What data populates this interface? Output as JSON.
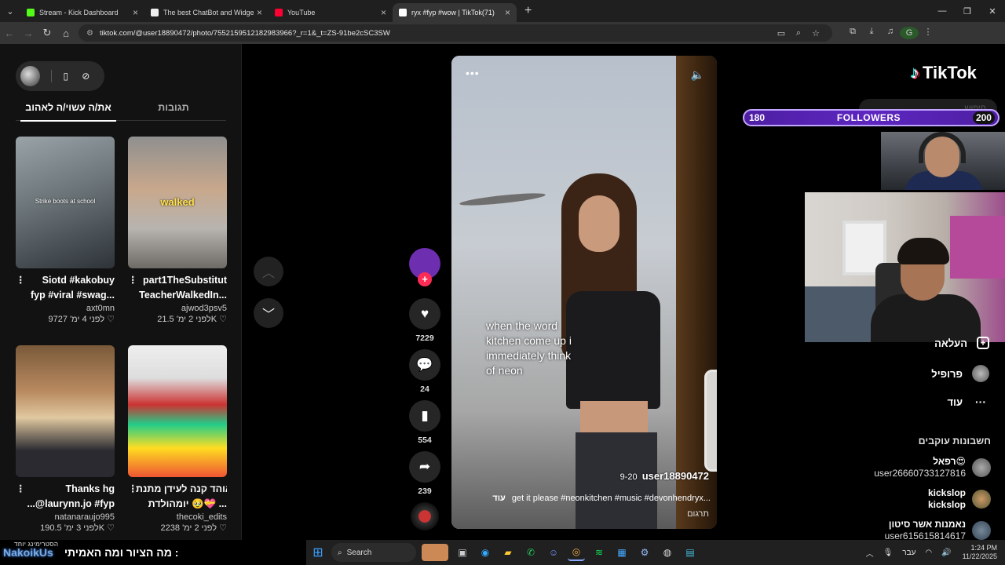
{
  "browser": {
    "tabs": [
      {
        "title": "Stream - Kick Dashboard",
        "color": "#53fc18",
        "active": false
      },
      {
        "title": "The best ChatBot and Widgets",
        "color": "#eeeeee",
        "active": false
      },
      {
        "title": "YouTube",
        "color": "#ff0033",
        "active": false
      },
      {
        "title": "ryx #fyp #wow | TikTok(71)",
        "color": "#ffffff",
        "active": true
      }
    ],
    "url": "tiktok.com/@user18890472/photo/7552159512182983966?_r=1&_t=ZS-91be2cSC3SW"
  },
  "left_panel": {
    "tabs": [
      {
        "label": "את/ה עשוי/ה לאהוב",
        "selected": true
      },
      {
        "label": "תגובות",
        "selected": false
      }
    ],
    "cards": [
      {
        "caption": "Strike boots at school",
        "title1": "Siotd #kakobuy",
        "title2": "fyp #viral #swag...",
        "author": "axt0mn",
        "meta": "לפני 4 ימ' 9727 ♡",
        "bg": "linear-gradient(160deg,#9aa3a8,#6b7478 45%,#2d3338)"
      },
      {
        "caption": "walked",
        "title1": "part1TheSubstitut",
        "title2": "TeacherWalkedIn...",
        "author": "ajwod3psv5",
        "meta": "לפני 2 ימ' 21.5K ♡",
        "bg": "linear-gradient(180deg,#8f8f8f,#c8a88c 40%,#b7b4b0 70%,#6e6a66)"
      },
      {
        "caption": "",
        "title1": "Thanks hg",
        "title2": "...@laurynn.jo #fyp",
        "author": "natanaraujo995",
        "meta": "לפני 3 ימ' 190.5K ♡",
        "bg": "linear-gradient(180deg,#7a5a3a,#b98a60 35%,#e0c8a0 55%,#2a2a30 80%)"
      },
      {
        "caption": "",
        "title1": "אוהד קנה לעידן מתנת",
        "title2": "יומהולדת 🥹💝 ...",
        "author": "thecoki_edits",
        "meta": "לפני 2 ימ' 2238 ♡",
        "bg": "linear-gradient(180deg,#eee 0%,#ddd 25%,#c33 45%,#2c8 60%,#fd2 78%,#e53 100%)"
      }
    ]
  },
  "video": {
    "overlay_text": [
      "when the word",
      "kitchen come up i",
      "immediately think",
      "of neon"
    ],
    "username": "user18890472",
    "date": "9-20",
    "description": "get it please #neonkitchen #music #devonhendryx...",
    "more_label": "עוד",
    "translate_label": "תרגום"
  },
  "actions": {
    "likes": "7229",
    "comments": "24",
    "saves": "554",
    "shares": "239"
  },
  "right_panel": {
    "logo": "TikTok",
    "search_placeholder": "חיפוש",
    "followers_overlay": {
      "current": "180",
      "label": "FOLLOWERS",
      "goal": "200"
    },
    "nav": [
      {
        "label": "העלאה",
        "icon": "upload-icon"
      },
      {
        "label": "פרופיל",
        "icon": "profile-icon"
      },
      {
        "label": "עוד",
        "icon": "more-icon"
      }
    ],
    "following_title": "חשבונות עוקבים",
    "following": [
      {
        "name": "רפאל😍",
        "user": "user26660733127816"
      },
      {
        "name": "kickslop",
        "user": "kickslop"
      },
      {
        "name": "נאמנות אשר סיטון",
        "user": "user615615814617"
      }
    ]
  },
  "chat_overlay": {
    "small": "הסטרימינג יוחד",
    "name": "NakoikUs",
    "message": "מה הציור ומה האמיתי :"
  },
  "taskbar": {
    "search": "Search",
    "lang": "עבר",
    "time": "1:24 PM",
    "date": "11/22/2025"
  }
}
